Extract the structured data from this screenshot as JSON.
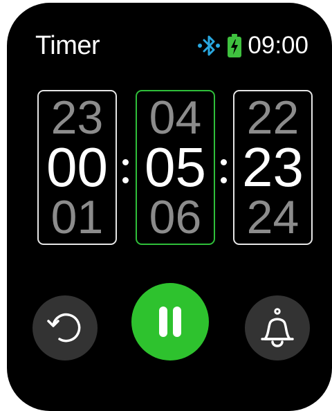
{
  "header": {
    "title": "Timer",
    "time": "09:00",
    "bluetooth_icon": "bluetooth-icon",
    "battery_icon": "battery-charging-icon"
  },
  "timer": {
    "hours": {
      "prev": "23",
      "current": "00",
      "next": "01"
    },
    "minutes": {
      "prev": "04",
      "current": "05",
      "next": "06"
    },
    "seconds": {
      "prev": "22",
      "current": "23",
      "next": "24"
    },
    "selected_field": "minutes"
  },
  "controls": {
    "reset_icon": "reset-icon",
    "pause_icon": "pause-icon",
    "alarm_icon": "bell-icon"
  },
  "colors": {
    "accent": "#2ec22e",
    "bluetooth": "#29a8e0",
    "battery": "#3fc13f"
  }
}
